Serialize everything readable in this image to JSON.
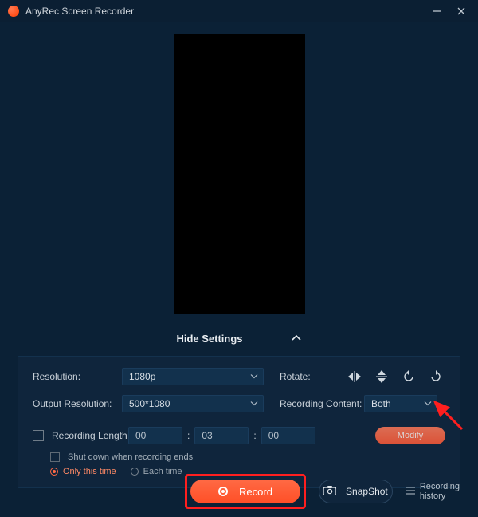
{
  "window": {
    "title": "AnyRec Screen Recorder"
  },
  "toggle": {
    "hide_settings": "Hide Settings"
  },
  "settings": {
    "resolution_label": "Resolution:",
    "resolution_value": "1080p",
    "output_label": "Output Resolution:",
    "output_value": "500*1080",
    "rotate_label": "Rotate:",
    "content_label": "Recording Content:",
    "content_value": "Both",
    "recording_length_label": "Recording Length",
    "time_h": "00",
    "time_m": "03",
    "time_s": "00",
    "modify_label": "Modify",
    "shutdown_label": "Shut down when recording ends",
    "only_this_time": "Only this time",
    "each_time": "Each time"
  },
  "buttons": {
    "record": "Record",
    "snapshot": "SnapShot"
  },
  "footer": {
    "history": "Recording history"
  }
}
